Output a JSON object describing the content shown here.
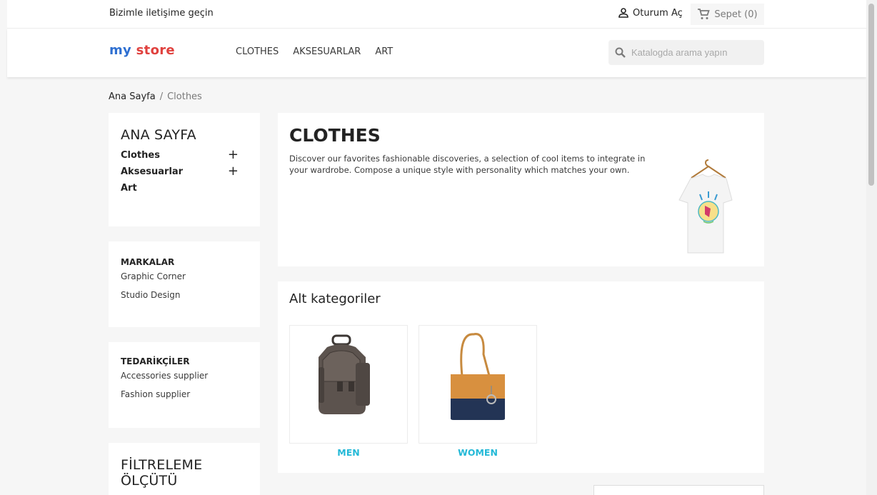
{
  "topbar": {
    "contact": "Bizimle iletişime geçin",
    "signin": "Oturum Aç",
    "cart": "Sepet (0)"
  },
  "header": {
    "logo_part1": "my",
    "logo_part2": "store",
    "nav": [
      "CLOTHES",
      "AKSESUARLAR",
      "ART"
    ],
    "search_placeholder": "Katalogda arama yapın"
  },
  "breadcrumb": {
    "home": "Ana Sayfa",
    "separator": "/",
    "current": "Clothes"
  },
  "sidebar": {
    "categories_title": "ANA SAYFA",
    "categories": [
      {
        "label": "Clothes",
        "expand": "+"
      },
      {
        "label": "Aksesuarlar",
        "expand": "+"
      },
      {
        "label": "Art",
        "expand": ""
      }
    ],
    "brands_title": "MARKALAR",
    "brands": [
      "Graphic Corner",
      "Studio Design"
    ],
    "suppliers_title": "TEDARİKÇİLER",
    "suppliers": [
      "Accessories supplier",
      "Fashion supplier"
    ],
    "filter_title": "FİLTRELEME ÖLÇÜTÜ"
  },
  "category": {
    "title": "CLOTHES",
    "description": "Discover our favorites fashionable discoveries, a selection of cool items to integrate in your wardrobe. Compose a unique style with personality which matches your own."
  },
  "subcategories": {
    "title": "Alt kategoriler",
    "items": [
      {
        "label": "MEN",
        "icon": "backpack-image"
      },
      {
        "label": "WOMEN",
        "icon": "handbag-image"
      }
    ]
  },
  "colors": {
    "accent": "#24b9d7",
    "logo_red": "#e0413e",
    "logo_blue": "#2e6fd1"
  }
}
